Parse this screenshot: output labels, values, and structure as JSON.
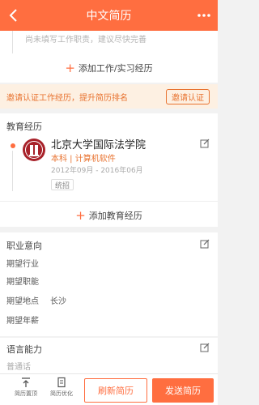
{
  "header": {
    "title": "中文简历"
  },
  "work": {
    "hint": "尚未填写工作职责，建议尽快完善",
    "add_label": "添加工作/实习经历"
  },
  "banner": {
    "text": "邀请认证工作经历，提升简历排名",
    "button_label": "邀请认证"
  },
  "education": {
    "title": "教育经历",
    "school": "北京大学国际法学院",
    "major": "本科 | 计算机软件",
    "date": "2012年09月 - 2016年06月",
    "tag": "统招",
    "add_label": "添加教育经历"
  },
  "intent": {
    "title": "职业意向",
    "rows": [
      {
        "label": "期望行业",
        "value": ""
      },
      {
        "label": "期望职能",
        "value": ""
      },
      {
        "label": "期望地点",
        "value": "长沙"
      },
      {
        "label": "期望年薪",
        "value": ""
      }
    ]
  },
  "language": {
    "title": "语言能力",
    "item": "普通话"
  },
  "bottom": {
    "tool1": "简历置顶",
    "tool2": "简历优化",
    "refresh_label": "刷新简历",
    "send_label": "发送简历"
  },
  "colors": {
    "accent": "#ff6e40",
    "banner_bg": "#fdf0e2",
    "banner_text": "#e8722f"
  }
}
